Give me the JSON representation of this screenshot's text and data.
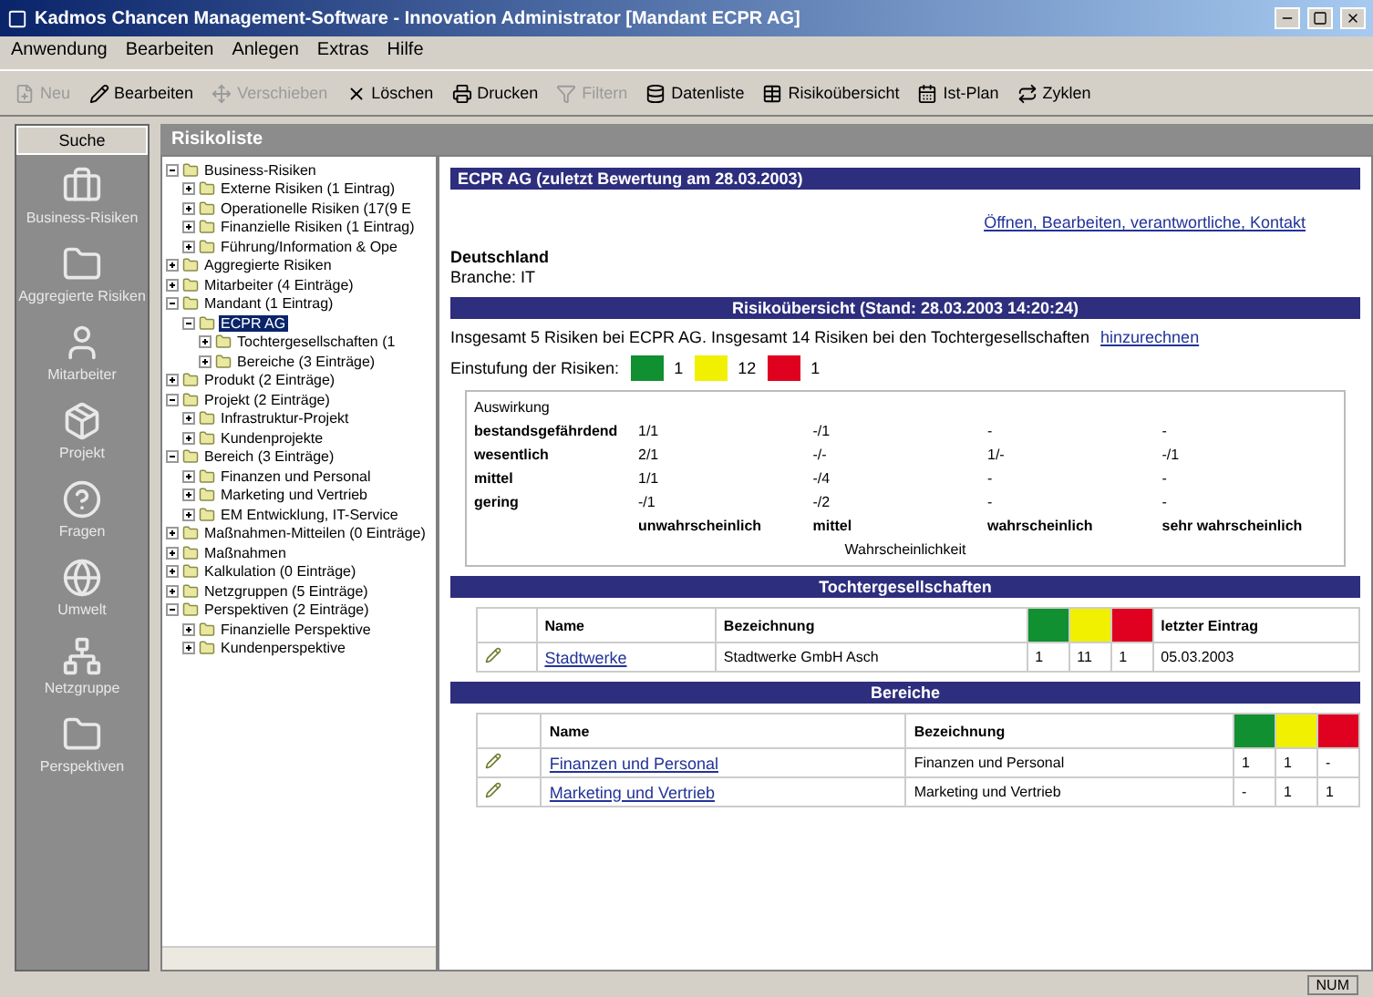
{
  "window": {
    "title": "Kadmos Chancen Management-Software - Innovation Administrator [Mandant ECPR AG]"
  },
  "menu": [
    "Anwendung",
    "Bearbeiten",
    "Anlegen",
    "Extras",
    "Hilfe"
  ],
  "toolbar": [
    {
      "label": "Neu",
      "disabled": true
    },
    {
      "label": "Bearbeiten",
      "disabled": false
    },
    {
      "label": "Verschieben",
      "disabled": true
    },
    {
      "label": "Löschen",
      "disabled": false
    },
    {
      "label": "Drucken",
      "disabled": false
    },
    {
      "label": "Filtern",
      "disabled": true
    },
    {
      "label": "Datenliste",
      "disabled": false
    },
    {
      "label": "Risikoübersicht",
      "disabled": false
    },
    {
      "label": "Ist-Plan",
      "disabled": false
    },
    {
      "label": "Zyklen",
      "disabled": false
    }
  ],
  "nav": {
    "title": "Suche",
    "items": [
      "Business-Risiken",
      "Aggregierte Risiken",
      "Mitarbeiter",
      "Projekt",
      "Fragen",
      "Umwelt",
      "Netzgruppe",
      "Perspektiven"
    ]
  },
  "tree": {
    "title": "Risikoliste",
    "items": [
      {
        "label": "Business-Risiken",
        "expanded": true,
        "selected": false,
        "children": [
          {
            "label": "Externe Risiken (1 Eintrag)",
            "expanded": false,
            "selected": false
          },
          {
            "label": "Operationelle Risiken (17(9 E",
            "expanded": false,
            "selected": false
          },
          {
            "label": "Finanzielle Risiken (1 Eintrag)",
            "expanded": false,
            "selected": false
          },
          {
            "label": "Führung/Information & Ope",
            "expanded": false,
            "selected": false
          }
        ]
      },
      {
        "label": "Aggregierte Risiken",
        "expanded": false,
        "selected": false
      },
      {
        "label": "Mitarbeiter (4 Einträge)",
        "expanded": false,
        "selected": false
      },
      {
        "label": "Mandant (1 Eintrag)",
        "expanded": true,
        "selected": false,
        "children": [
          {
            "label": "ECPR AG",
            "expanded": true,
            "selected": true,
            "children": [
              {
                "label": "Tochtergesellschaften (1",
                "expanded": false,
                "selected": false
              },
              {
                "label": "Bereiche (3 Einträge)",
                "expanded": false,
                "selected": false
              }
            ]
          }
        ]
      },
      {
        "label": "Produkt (2 Einträge)",
        "expanded": false,
        "selected": false
      },
      {
        "label": "Projekt (2 Einträge)",
        "expanded": true,
        "selected": false,
        "children": [
          {
            "label": "Infrastruktur-Projekt",
            "expanded": false,
            "selected": false
          },
          {
            "label": "Kundenprojekte",
            "expanded": false,
            "selected": false
          }
        ]
      },
      {
        "label": "Bereich (3 Einträge)",
        "expanded": true,
        "selected": false,
        "children": [
          {
            "label": "Finanzen und Personal",
            "expanded": false,
            "selected": false
          },
          {
            "label": "Marketing und Vertrieb",
            "expanded": false,
            "selected": false
          },
          {
            "label": "EM Entwicklung, IT-Service",
            "expanded": false,
            "selected": false
          }
        ]
      },
      {
        "label": "Maßnahmen-Mitteilen (0 Einträge)",
        "expanded": false,
        "selected": false
      },
      {
        "label": "Maßnahmen",
        "expanded": false,
        "selected": false
      },
      {
        "label": "Kalkulation (0 Einträge)",
        "expanded": false,
        "selected": false
      },
      {
        "label": "Netzgruppen (5 Einträge)",
        "expanded": false,
        "selected": false
      },
      {
        "label": "Perspektiven (2 Einträge)",
        "expanded": true,
        "selected": false,
        "children": [
          {
            "label": "Finanzielle Perspektive",
            "expanded": false,
            "selected": false
          },
          {
            "label": "Kundenperspektive",
            "expanded": false,
            "selected": false
          }
        ]
      }
    ]
  },
  "content": {
    "company_header": "ECPR AG (zuletzt Bewertung am 28.03.2003)",
    "links": "Öffnen, Bearbeiten, verantwortliche, Kontakt",
    "country": "Deutschland",
    "branch": "Branche: IT",
    "overview_header": "Risikoübersicht (Stand: 28.03.2003 14:20:24)",
    "summary": "Insgesamt 5 Risiken bei ECPR AG. Insgesamt 14 Risiken bei den Tochtergesellschaften",
    "summary_link": "hinzurechnen",
    "rating_label": "Einstufung der Risiken:",
    "ratings": [
      {
        "color": "#109030",
        "count": "1"
      },
      {
        "color": "#f0f000",
        "count": "12"
      },
      {
        "color": "#e00020",
        "count": "1"
      }
    ],
    "matrix": {
      "title": "Auswirkung",
      "rows": [
        {
          "label": "bestandsgefährdend",
          "cells": [
            "1/1",
            "-/1",
            "-",
            "-"
          ]
        },
        {
          "label": "wesentlich",
          "cells": [
            "2/1",
            "-/-",
            "1/-",
            "-/1"
          ]
        },
        {
          "label": "mittel",
          "cells": [
            "1/1",
            "-/4",
            "-",
            "-"
          ]
        },
        {
          "label": "gering",
          "cells": [
            "-/1",
            "-/2",
            "-",
            "-"
          ]
        }
      ],
      "probability_labels": [
        "unwahrscheinlich",
        "mittel",
        "wahrscheinlich",
        "sehr wahrscheinlich"
      ],
      "axis": "Wahrscheinlichkeit"
    },
    "subsidiaries": {
      "header": "Tochtergesellschaften",
      "columns": [
        "Name",
        "Bezeichnung",
        "letzter Eintrag"
      ],
      "rows": [
        {
          "name": "Stadtwerke",
          "description": "Stadtwerke GmbH Asch",
          "counts": [
            "1",
            "11",
            "1"
          ],
          "date": "05.03.2003"
        }
      ]
    },
    "departments": {
      "header": "Bereiche",
      "columns": [
        "Name",
        "Bezeichnung"
      ],
      "rows": [
        {
          "name": "Finanzen und Personal",
          "description": "Finanzen und Personal",
          "counts": [
            "1",
            "1",
            "-"
          ]
        },
        {
          "name": "Marketing und Vertrieb",
          "description": "Marketing und Vertrieb",
          "counts": [
            "-",
            "1",
            "1"
          ]
        }
      ]
    }
  },
  "status_bar": {
    "mode": "NUM"
  }
}
